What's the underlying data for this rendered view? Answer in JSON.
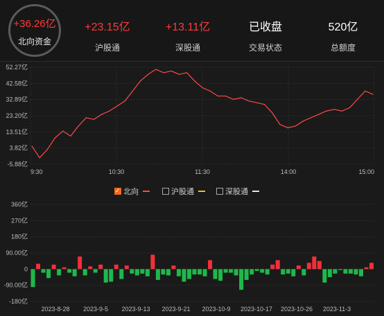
{
  "header": {
    "total": {
      "value": "+36.26亿",
      "label": "北向资金"
    },
    "stats": [
      {
        "value": "+23.15亿",
        "label": "沪股通",
        "color": "#ff3b3b"
      },
      {
        "value": "+13.11亿",
        "label": "深股通",
        "color": "#ff3b3b"
      },
      {
        "value": "已收盘",
        "label": "交易状态",
        "color": "#ffffff"
      },
      {
        "value": "520亿",
        "label": "总额度",
        "color": "#ffffff"
      }
    ]
  },
  "legend": [
    {
      "label": "北向",
      "checked": true,
      "color": "#ff4a4a"
    },
    {
      "label": "沪股通",
      "checked": false,
      "color": "#f2c21b"
    },
    {
      "label": "深股通",
      "checked": false,
      "color": "#e6e6e6"
    }
  ],
  "chart_data": [
    {
      "type": "line",
      "series": [
        {
          "name": "北向",
          "color": "#ff4a4a"
        }
      ],
      "y_ticks": [
        "52.27亿",
        "42.58亿",
        "32.89亿",
        "23.20亿",
        "13.51亿",
        "3.82亿",
        "-5.88亿"
      ],
      "ylim": [
        -5.88,
        52.27
      ],
      "x_ticks": [
        "9:30",
        "10:30",
        "11:30",
        "14:00",
        "15:00"
      ],
      "x": [
        "9:30",
        "9:34",
        "9:38",
        "9:42",
        "9:46",
        "9:50",
        "9:55",
        "10:00",
        "10:06",
        "10:12",
        "10:18",
        "10:24",
        "10:30",
        "10:36",
        "10:42",
        "10:48",
        "10:54",
        "11:00",
        "11:06",
        "11:10",
        "11:14",
        "11:18",
        "11:22",
        "11:26",
        "11:30",
        "13:06",
        "13:12",
        "13:18",
        "13:24",
        "13:30",
        "13:36",
        "13:42",
        "13:48",
        "13:54",
        "14:00",
        "14:06",
        "14:12",
        "14:18",
        "14:24",
        "14:30",
        "14:36",
        "14:42",
        "14:48",
        "14:54",
        "15:00"
      ],
      "values": [
        5,
        -2,
        3,
        10,
        14,
        11,
        17,
        22,
        21,
        24,
        26,
        29,
        32,
        38,
        44,
        48,
        51,
        49,
        50,
        48,
        49,
        44,
        40,
        38,
        35,
        35,
        33,
        34,
        32,
        31,
        30,
        25,
        18,
        16,
        17,
        20,
        22,
        24,
        26,
        27,
        26,
        28,
        33,
        38,
        36
      ]
    },
    {
      "type": "bar",
      "y_ticks": [
        "360亿",
        "270亿",
        "180亿",
        "90.00亿",
        "0",
        "-90.00亿",
        "-180亿"
      ],
      "ylim": [
        -180,
        360
      ],
      "x_ticks": [
        "2023-8-28",
        "2023-9-5",
        "2023-9-13",
        "2023-9-21",
        "2023-10-9",
        "2023-10-17",
        "2023-10-26",
        "2023-11-3"
      ],
      "values": [
        -100,
        30,
        -20,
        -50,
        25,
        -35,
        10,
        -20,
        -40,
        70,
        -35,
        15,
        -20,
        25,
        -75,
        -70,
        25,
        -55,
        20,
        -25,
        -35,
        -25,
        -40,
        80,
        -60,
        -30,
        -35,
        20,
        -40,
        -70,
        -55,
        -30,
        -30,
        -40,
        50,
        -55,
        -65,
        -20,
        -20,
        -35,
        -115,
        -60,
        -30,
        -10,
        -20,
        -30,
        25,
        50,
        -30,
        -25,
        -40,
        20,
        -35,
        35,
        70,
        45,
        -75,
        -45,
        -25,
        -5,
        -25,
        -25,
        -30,
        -40,
        10,
        35
      ]
    }
  ]
}
